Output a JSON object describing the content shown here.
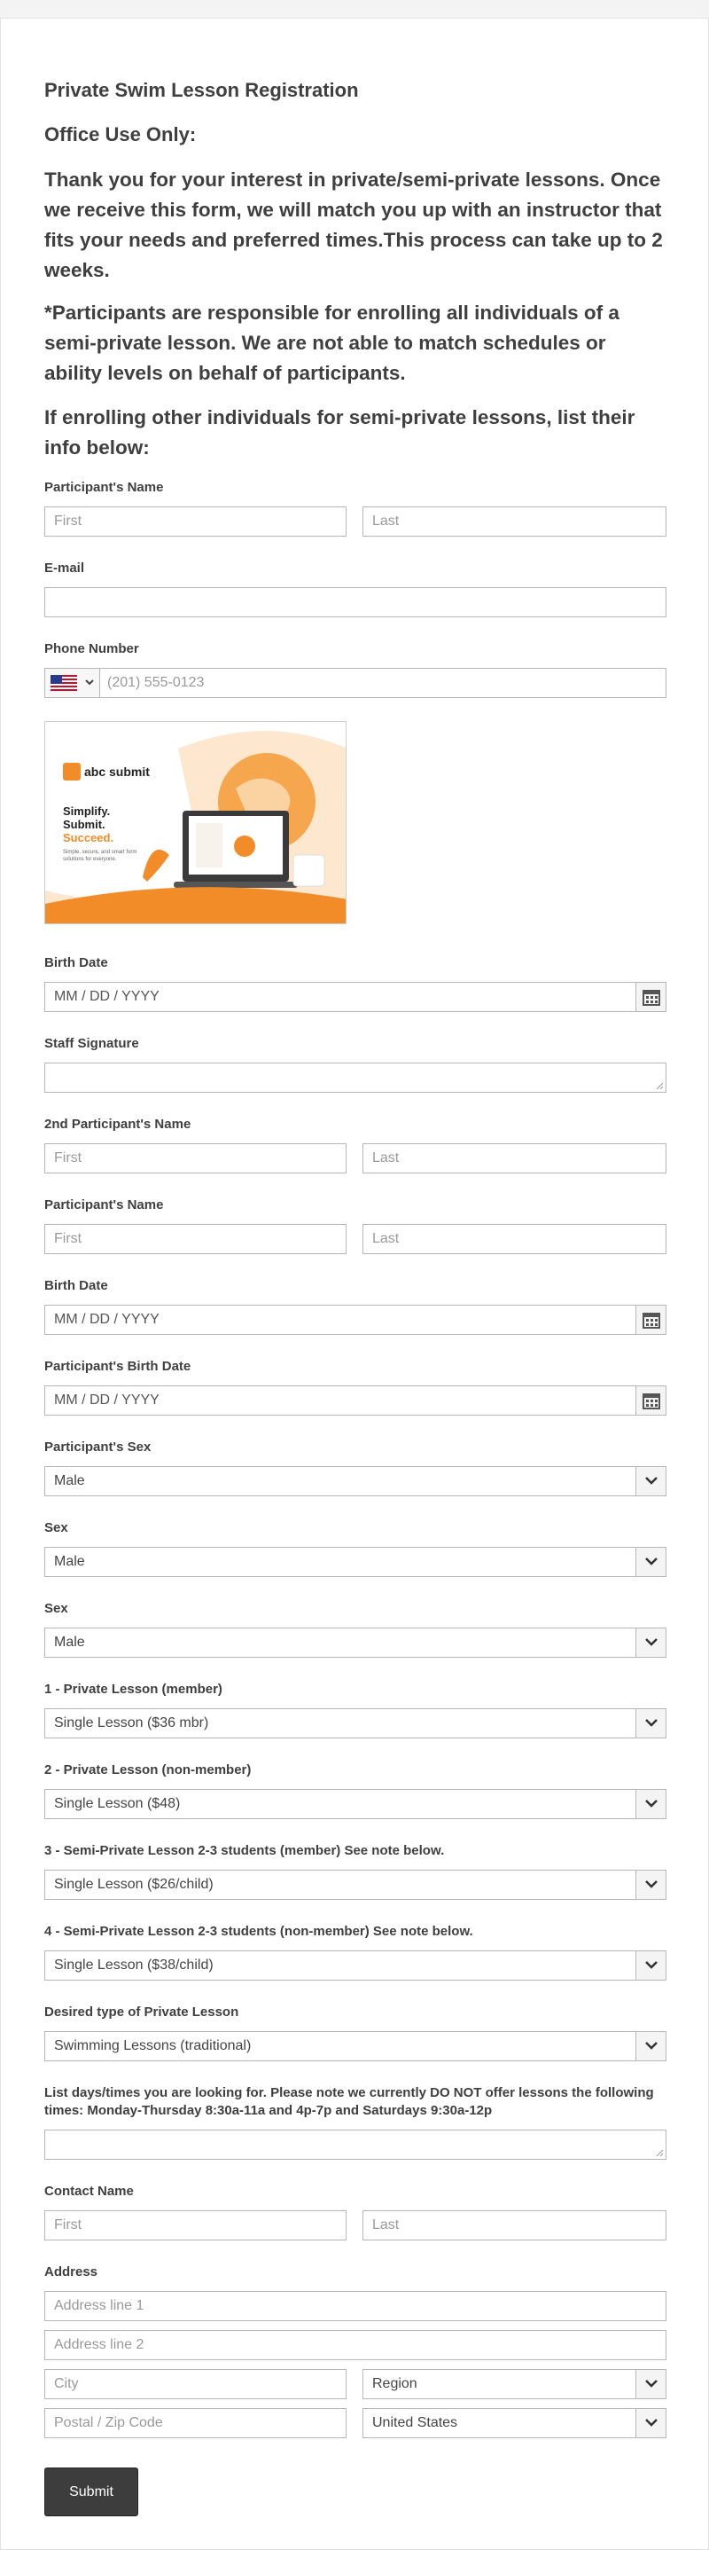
{
  "form": {
    "title": "Private Swim Lesson Registration",
    "office_use": "Office Use Only:",
    "intro": "Thank you for your interest in private/semi-private lessons. Once we receive this form, we will match you up with an instructor that fits your needs and preferred times.This process can take up to 2 weeks.",
    "note": "*Participants are responsible for enrolling all individuals of a semi-private lesson. We are not able to match schedules or ability levels on behalf of participants.",
    "other_heading": "If enrolling other individuals for semi-private lessons, list their info below:",
    "submit_label": "Submit"
  },
  "fields": {
    "participant_name": {
      "label": "Participant's Name",
      "first": "First",
      "last": "Last"
    },
    "email": {
      "label": "E-mail"
    },
    "phone": {
      "label": "Phone Number",
      "placeholder": "(201) 555-0123"
    },
    "banner": {
      "brand": "abc submit",
      "line1": "Simplify.",
      "line2": "Submit.",
      "line3": "Succeed.",
      "tagline": "Simple, secure, and smart form solutions for everyone."
    },
    "birth_date_1": {
      "label": "Birth Date",
      "placeholder": "MM / DD / YYYY"
    },
    "staff_signature": {
      "label": "Staff Signature"
    },
    "participant2_name": {
      "label": "2nd Participant's Name",
      "first": "First",
      "last": "Last"
    },
    "participant_name_b": {
      "label": "Participant's Name",
      "first": "First",
      "last": "Last"
    },
    "birth_date_2": {
      "label": "Birth Date",
      "placeholder": "MM / DD / YYYY"
    },
    "participant_birth_date": {
      "label": "Participant's Birth Date",
      "placeholder": "MM / DD / YYYY"
    },
    "participant_sex": {
      "label": "Participant's Sex",
      "value": "Male"
    },
    "sex_1": {
      "label": "Sex",
      "value": "Male"
    },
    "sex_2": {
      "label": "Sex",
      "value": "Male"
    },
    "private_member": {
      "label": "1 - Private Lesson (member)",
      "value": "Single Lesson ($36 mbr)"
    },
    "private_nonmember": {
      "label": "2 - Private Lesson (non-member)",
      "value": "Single Lesson ($48)"
    },
    "semi_member": {
      "label": "3 - Semi-Private Lesson 2-3 students (member) See note below.",
      "value": "Single Lesson ($26/child)"
    },
    "semi_nonmember": {
      "label": "4 - Semi-Private Lesson 2-3 students (non-member) See note below.",
      "value": "Single Lesson ($38/child)"
    },
    "lesson_type": {
      "label": "Desired type of Private Lesson",
      "value": "Swimming Lessons (traditional)"
    },
    "days_times": {
      "label": "List days/times you are looking for. Please note we currently DO NOT offer lessons the following times: Monday-Thursday 8:30a-11a and 4p-7p and Saturdays 9:30a-12p"
    },
    "contact_name": {
      "label": "Contact Name",
      "first": "First",
      "last": "Last"
    },
    "address": {
      "label": "Address",
      "line1": "Address line 1",
      "line2": "Address line 2",
      "city": "City",
      "region": "Region",
      "postal": "Postal / Zip Code",
      "country": "United States"
    }
  },
  "icons": {
    "flag": "us-flag-icon",
    "calendar": "calendar-icon",
    "chevron": "chevron-down-icon"
  },
  "colors": {
    "button": "#3d3d3d",
    "accent": "#f28c28"
  }
}
